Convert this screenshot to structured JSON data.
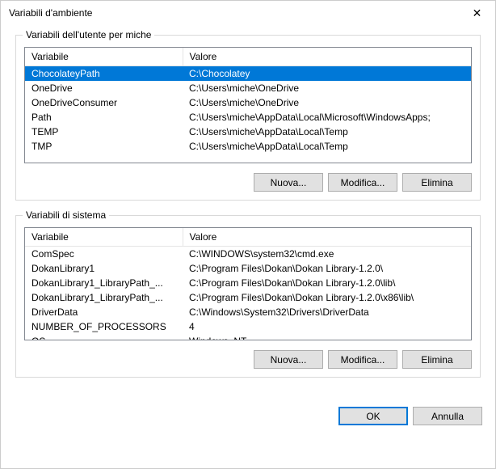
{
  "window": {
    "title": "Variabili d'ambiente",
    "close_glyph": "✕"
  },
  "user_section": {
    "label": "Variabili dell'utente per miche",
    "columns": {
      "variable": "Variabile",
      "value": "Valore"
    },
    "rows": [
      {
        "variable": "ChocolateyPath",
        "value": "C:\\Chocolatey",
        "selected": true
      },
      {
        "variable": "OneDrive",
        "value": "C:\\Users\\miche\\OneDrive"
      },
      {
        "variable": "OneDriveConsumer",
        "value": "C:\\Users\\miche\\OneDrive"
      },
      {
        "variable": "Path",
        "value": "C:\\Users\\miche\\AppData\\Local\\Microsoft\\WindowsApps;"
      },
      {
        "variable": "TEMP",
        "value": "C:\\Users\\miche\\AppData\\Local\\Temp"
      },
      {
        "variable": "TMP",
        "value": "C:\\Users\\miche\\AppData\\Local\\Temp"
      }
    ],
    "buttons": {
      "new": "Nuova...",
      "edit": "Modifica...",
      "delete": "Elimina"
    }
  },
  "system_section": {
    "label": "Variabili di sistema",
    "columns": {
      "variable": "Variabile",
      "value": "Valore"
    },
    "rows": [
      {
        "variable": "ComSpec",
        "value": "C:\\WINDOWS\\system32\\cmd.exe"
      },
      {
        "variable": "DokanLibrary1",
        "value": "C:\\Program Files\\Dokan\\Dokan Library-1.2.0\\"
      },
      {
        "variable": "DokanLibrary1_LibraryPath_...",
        "value": "C:\\Program Files\\Dokan\\Dokan Library-1.2.0\\lib\\"
      },
      {
        "variable": "DokanLibrary1_LibraryPath_...",
        "value": "C:\\Program Files\\Dokan\\Dokan Library-1.2.0\\x86\\lib\\"
      },
      {
        "variable": "DriverData",
        "value": "C:\\Windows\\System32\\Drivers\\DriverData"
      },
      {
        "variable": "NUMBER_OF_PROCESSORS",
        "value": "4"
      },
      {
        "variable": "OS",
        "value": "Windows_NT"
      }
    ],
    "buttons": {
      "new": "Nuova...",
      "edit": "Modifica...",
      "delete": "Elimina"
    }
  },
  "dialog_buttons": {
    "ok": "OK",
    "cancel": "Annulla"
  }
}
